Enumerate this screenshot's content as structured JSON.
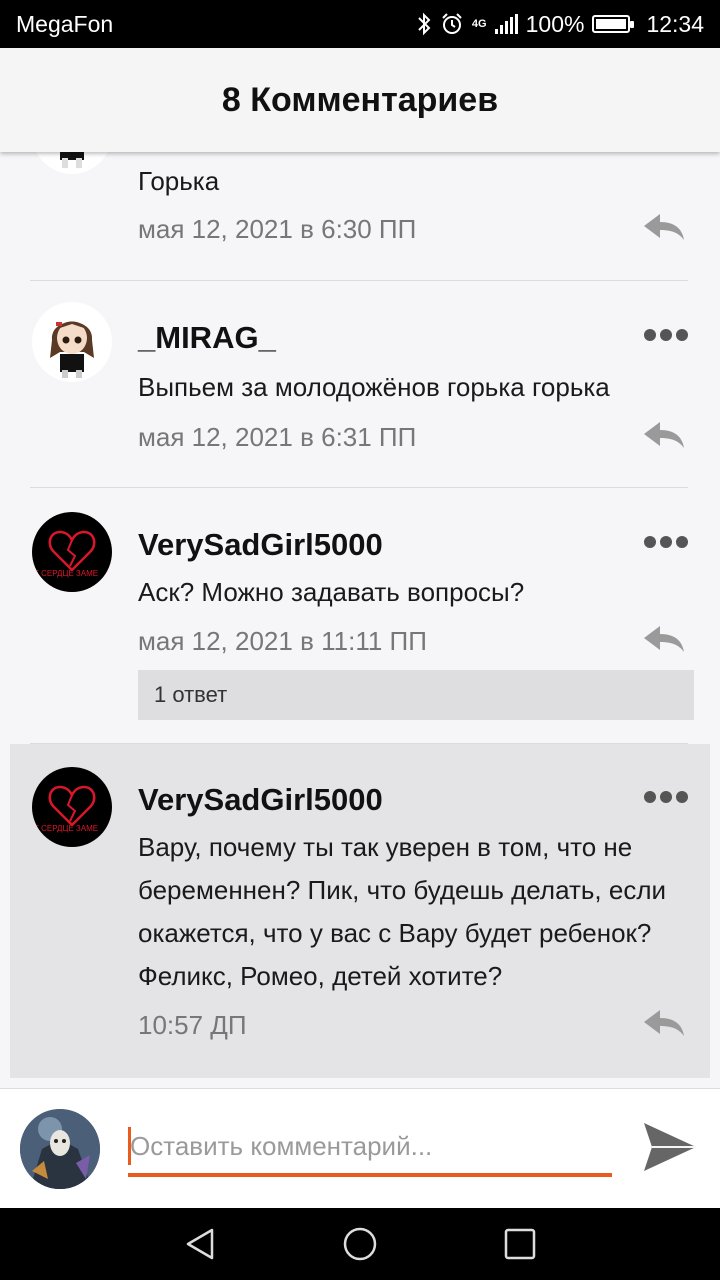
{
  "status_bar": {
    "carrier": "MegaFon",
    "network": "4G",
    "battery": "100%",
    "time": "12:34",
    "icons": [
      "bluetooth-icon",
      "alarm-icon",
      "signal-icon",
      "battery-icon"
    ]
  },
  "header": {
    "title": "8 Комментариев"
  },
  "comments": [
    {
      "username": "",
      "text": "Горька",
      "meta": "мая 12, 2021 в 6:30 ПП",
      "avatar": "anime-girl-avatar"
    },
    {
      "username": "_MIRAG_",
      "text": "Выпьем за молодожёнов горька горька",
      "meta": "мая 12, 2021 в 6:31 ПП",
      "avatar": "anime-girl-avatar"
    },
    {
      "username": "VerySadGirl5000",
      "text": "Аск? Можно задавать вопросы?",
      "meta": "мая 12, 2021 в 11:11 ПП",
      "avatar": "broken-heart-avatar",
      "avatar_caption": "Т СЕРДЦЕ ЗАМЕ",
      "replies_label": "1 ответ"
    },
    {
      "username": "VerySadGirl5000",
      "text": "Вару, почему ты так уверен в том, что не беременнен? Пик, что будешь делать, если окажется, что у вас с Вару будет ребенок? Феликс, Ромео, детей хотите?",
      "meta": "10:57 ДП",
      "avatar": "broken-heart-avatar",
      "avatar_caption": "Т СЕРДЦЕ ЗАМЕ"
    }
  ],
  "composer": {
    "placeholder": "Оставить комментарий...",
    "value": ""
  },
  "colors": {
    "accent": "#e85c1d",
    "highlight": "#e4e3e6",
    "background": "#f6f5f8",
    "heart": "#d8182a"
  }
}
